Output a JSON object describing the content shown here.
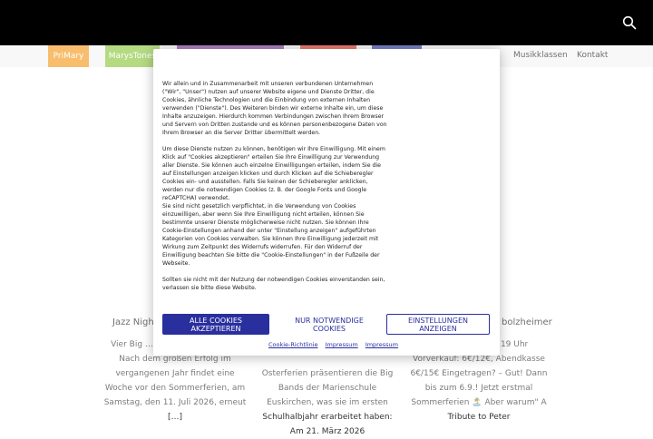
{
  "header": {
    "search_icon": "search-icon",
    "nav_buttons": [
      {
        "label": "PriMary",
        "color": "#f59a1f"
      },
      {
        "label": "MarysTones",
        "color": "#8cc63f"
      },
      {
        "label": "",
        "color": "#7c3b9a"
      },
      {
        "label": "",
        "color": "#e0301e"
      },
      {
        "label": "",
        "color": "#2b3aa0"
      }
    ],
    "nav_links": [
      "Musikklassen",
      "Kontakt"
    ]
  },
  "background": {
    "left_title": "Jazz Night",
    "right_title": "bolzheimer",
    "left_text": "Vier Big … Programm … Eintritt Nach dem großen Erfolg im vergangenen Jahr findet eine Woche vor den Sommerferien, am Samstag, den 11. Juli 2026, erneut […]",
    "mid_text": "Osterferien präsentieren die Big Bands der Marienschule Euskirchen, was sie im ersten Schulhalbjahr erarbeitet haben: Am 21. März 2026",
    "right_text": "für den 09.2025, 19 Uhr Vorverkauf: 6€/12€, Abendkasse 6€/15€ Eingetragen? – Gut! Dann bis zum 6.9.! Jetzt erstmal Sommerferien 🏝️ Aber warum\" A Tribute to Peter"
  },
  "consent": {
    "paragraph1": "Wir allein und in Zusammenarbeit mit unseren verbundenen Unternehmen (\"Wir\", \"Unser\") nutzen auf unserer Website eigene und Dienste Dritter, die Cookies, ähnliche Technologien und die Einbindung von externen Inhalten verwenden (\"Dienste\"). Des Weiteren binden wir externe Inhalte ein, um diese Inhalte anzuzeigen. Hierdurch kommen Verbindungen zwischen Ihrem Browser und Servern von Dritten zustande und es können personenbezogene Daten von Ihrem Browser an die Server Dritter übermittelt werden.",
    "paragraph2": "Um diese Dienste nutzen zu können, benötigen wir Ihre Einwilligung. Mit einem Klick auf \"Cookies akzeptieren\" erteilen Sie Ihre Einwilligung zur Verwendung aller Dienste. Sie können auch einzelne Einwilligungen erteilen, indem Sie die auf Einstellungen anzeigen klicken und durch Klicken auf die Schieberegler Cookies ein- und ausstellen. Falls Sie keinen der Schieberegler anklicken, werden nur die notwendigen Cookies (z. B. der Google Fonts und Google reCAPTCHA) verwendet.",
    "paragraph3": "Sie sind nicht gesetzlich verpflichtet, in die Verwendung von Cookies einzuwilligen, aber wenn Sie Ihre Einwilligung nicht erteilen, können Sie bestimmte unserer Dienste möglicherweise nicht nutzen. Sie können Ihre Cookie-Einstellungen anhand der unter \"Einstellung anzeigen\" aufgeführten Kategorien von Cookies verwalten. Sie können Ihre Einwilligung jederzeit mit Wirkung zum Zeitpunkt des Widerrufs widerrufen. Für den Widerruf der Einwilligung beachten Sie bitte die \"Cookie-Einstellungen\" in der Fußzeile der Webseite.",
    "paragraph4": "Sollten sie nicht mit der Nutzung der notwendigen Cookies einverstanden sein, verlassen sie bitte diese Website.",
    "accept_all": "ALLE COOKIES AKZEPTIEREN",
    "necessary_only": "NUR NOTWENDIGE COOKIES",
    "show_settings": "EINSTELLUNGEN ANZEIGEN",
    "links": [
      "Cookie-Richtlinie",
      "Impressum",
      "Impressum"
    ],
    "accent": "#2a2f9e"
  }
}
